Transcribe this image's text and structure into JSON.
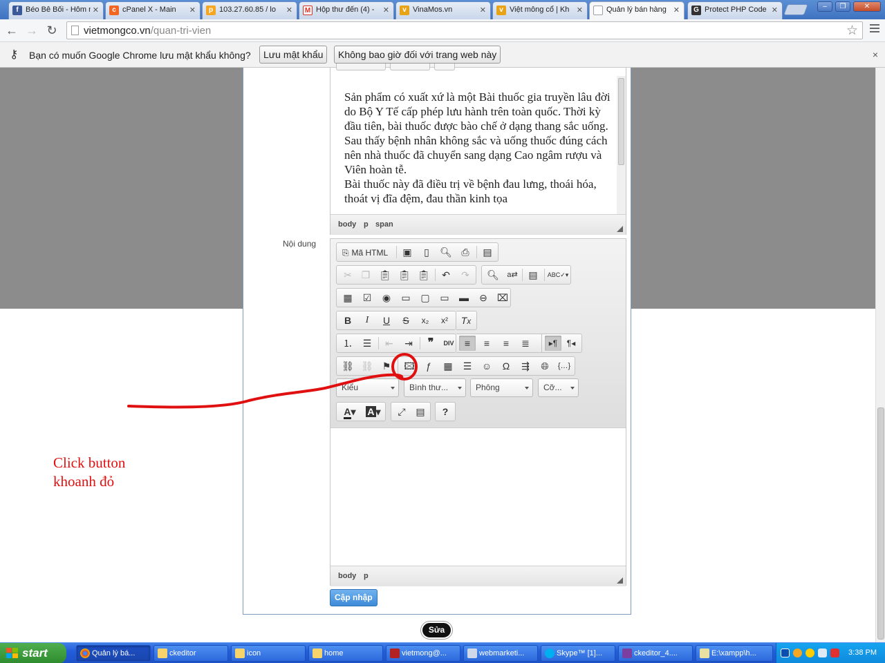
{
  "browser": {
    "tabs": [
      {
        "title": "Béo Bê Bối - Hôm n",
        "icon": "facebook-icon",
        "color": "#3b5998"
      },
      {
        "title": "cPanel X - Main",
        "icon": "cpanel-icon",
        "color": "#f26522"
      },
      {
        "title": "103.27.60.85 / lo",
        "icon": "phpmyadmin-icon",
        "color": "#f5a623"
      },
      {
        "title": "Hộp thư đến (4) -",
        "icon": "gmail-icon",
        "color": "#d93025"
      },
      {
        "title": "VinaMos.vn",
        "icon": "vinamos-icon",
        "color": "#e8a317"
      },
      {
        "title": "Việt mông cổ | Kh",
        "icon": "site-icon",
        "color": "#e8a317"
      },
      {
        "title": "Quản lý bán hàng",
        "icon": "page-icon",
        "color": "#9aa0a6"
      },
      {
        "title": "Protect PHP Code",
        "icon": "gsite-icon",
        "color": "#333333"
      }
    ],
    "active_tab_index": 6,
    "url_host": "vietmongco.vn",
    "url_path": "/quan-tri-vien"
  },
  "infobar": {
    "message": "Bạn có muốn Google Chrome lưu mật khẩu không?",
    "save_label": "Lưu mật khẩu",
    "never_label": "Không bao giờ đối với trang web này",
    "close": "×"
  },
  "editor1": {
    "paragraphs": [
      "Sản phẩm có xuất xứ là một Bài thuốc gia truyền lâu đời do Bộ Y Tế cấp phép lưu hành trên toàn quốc. Thời kỳ đầu tiên, bài thuốc được bào chế ở dạng thang sắc uống. Sau thấy bệnh nhân không sắc và uống thuốc đúng cách nên nhà thuốc đã chuyển sang dạng Cao ngâm rượu và Viên hoàn tễ.",
      "Bài thuốc này đã điều trị về bệnh đau lưng, thoái hóa, thoát vị đĩa đệm, đau thần kinh tọa"
    ],
    "path": [
      "body",
      "p",
      "span"
    ]
  },
  "form": {
    "content_label": "Nội dung",
    "update_button": "Cập nhập"
  },
  "editor2": {
    "source_label": "Mã HTML",
    "combos": {
      "styles": "Kiểu",
      "format": "Bình thư...",
      "font": "Phông",
      "size": "Cỡ..."
    },
    "path": [
      "body",
      "p"
    ]
  },
  "floating": {
    "edit_label": "Sửa"
  },
  "annotation": {
    "line1": "Click button",
    "line2": "khoanh đỏ",
    "color": "#e01010"
  },
  "taskbar": {
    "start_label": "start",
    "tasks": [
      {
        "label": "Quản lý bá...",
        "icon": "chrome-icon"
      },
      {
        "label": "ckeditor",
        "icon": "folder-icon"
      },
      {
        "label": "icon",
        "icon": "folder-icon"
      },
      {
        "label": "home",
        "icon": "folder-icon"
      },
      {
        "label": "vietmong@...",
        "icon": "filezilla-icon"
      },
      {
        "label": "webmarketi...",
        "icon": "box-icon"
      },
      {
        "label": "Skype™ [1]...",
        "icon": "skype-icon"
      },
      {
        "label": "ckeditor_4....",
        "icon": "winrar-icon"
      },
      {
        "label": "E:\\xampp\\h...",
        "icon": "notepad-icon"
      }
    ],
    "clock": "3:38 PM"
  }
}
